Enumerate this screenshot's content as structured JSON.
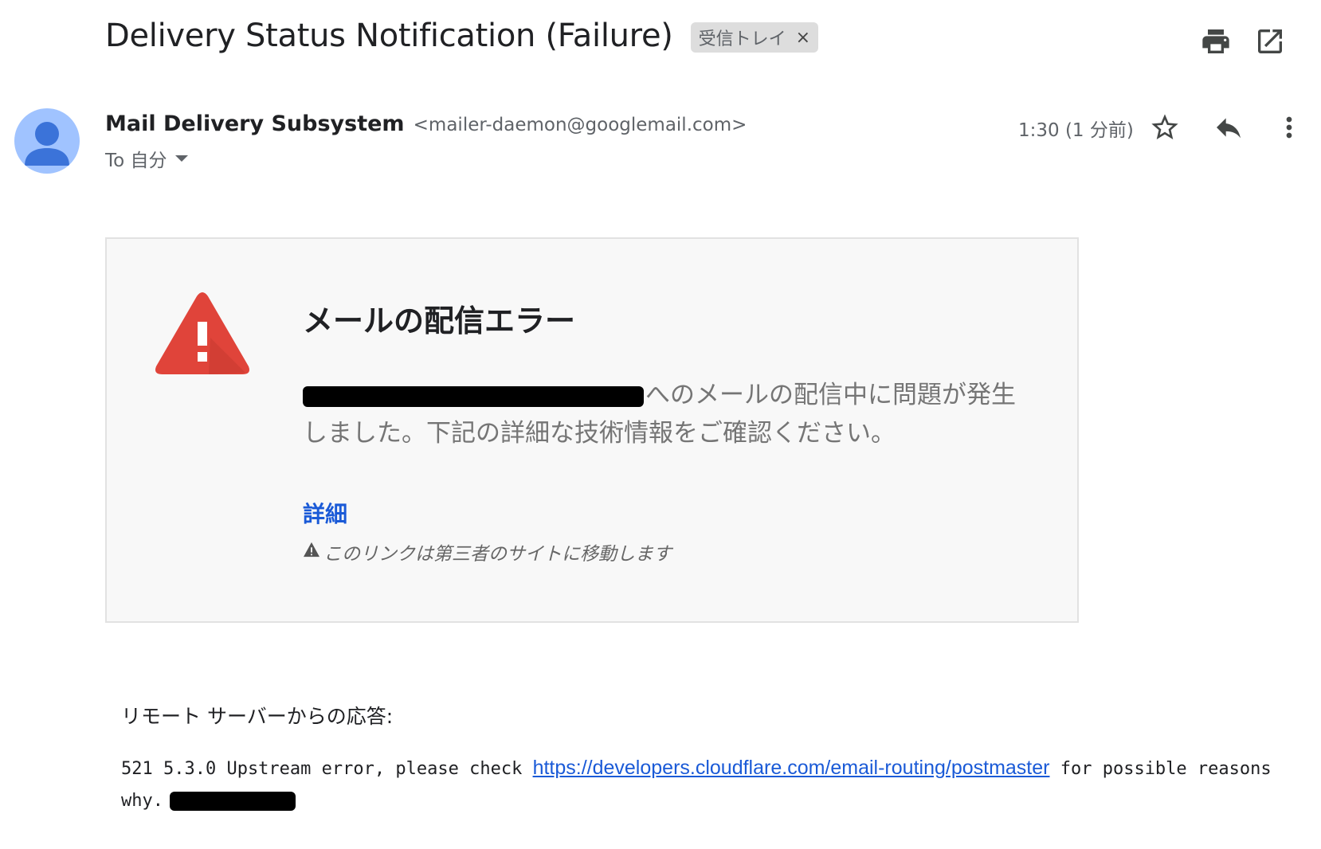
{
  "header": {
    "subject": "Delivery Status Notification (Failure)",
    "label_chip": "受信トレイ",
    "chip_close": "×",
    "icons": [
      "print-icon",
      "open-in-new-window-icon"
    ]
  },
  "message_header": {
    "sender_name": "Mail Delivery Subsystem",
    "sender_email": "<mailer-daemon@googlemail.com>",
    "recipient": "To 自分",
    "time": "1:30 (1 分前)",
    "icons": [
      "star-icon",
      "reply-icon",
      "more-vert-icon"
    ]
  },
  "error_card": {
    "title": "メールの配信エラー",
    "message_line1": "へのメールの配信中に問題が発生",
    "message_line2": "しました。下記の詳細な技術情報をご確認ください。",
    "details_link": "詳細",
    "third_party_note": "このリンクは第三者のサイトに移動します"
  },
  "remote_response": {
    "label": "リモート サーバーからの応答:",
    "code_text_before": "521 5.3.0 Upstream error, please check ",
    "link": "https://developers.cloudflare.com/email-routing/postmaster",
    "code_text_after": " for possible reasons why."
  },
  "colors": {
    "avatar_bg": "#a0c3ff",
    "avatar_fg": "#3b73d9",
    "warning_red": "#e0443a",
    "link_blue": "#1a5ad7"
  }
}
